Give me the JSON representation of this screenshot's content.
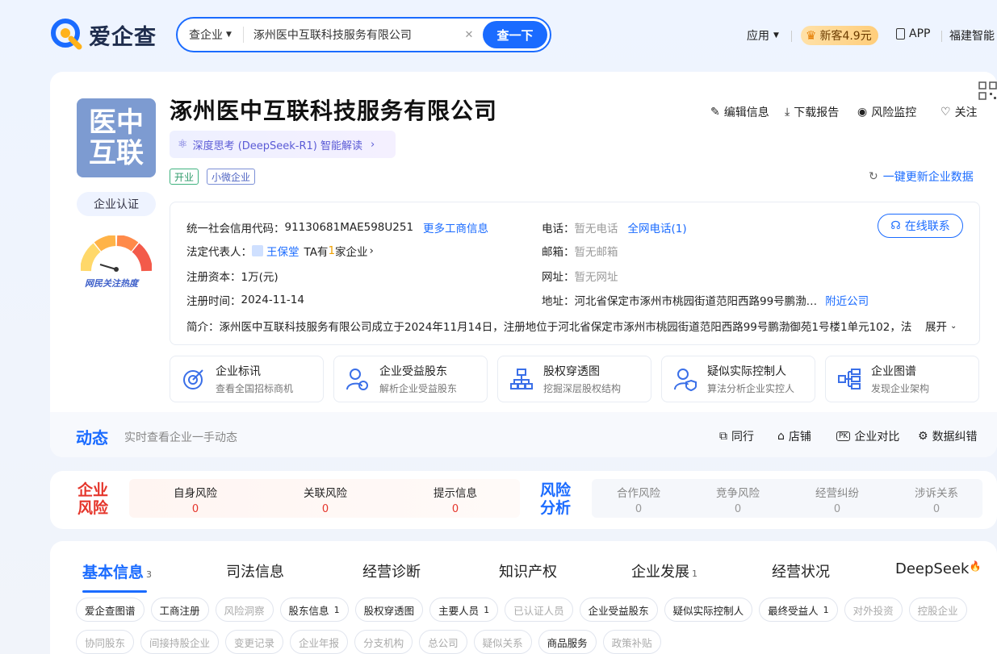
{
  "header": {
    "logo_text": "爱企查",
    "search_type": "查企业",
    "search_value": "涿州医中互联科技服务有限公司",
    "search_button": "查一下",
    "nav_apps": "应用",
    "vip_label": "新客4.9元",
    "nav_app": "APP",
    "nav_more": "福建智能"
  },
  "company": {
    "logo_text_1": "医中",
    "logo_text_2": "互联",
    "certify": "企业认证",
    "heat_label": "网民关注热度",
    "name": "涿州医中互联科技服务有限公司",
    "ai_label": "深度思考 (DeepSeek-R1) 智能解读",
    "tags": [
      "开业",
      "小微企业"
    ],
    "actions": [
      "编辑信息",
      "下载报告",
      "风险监控",
      "关注"
    ],
    "refresh": "一键更新企业数据",
    "credit_code_label": "统一社会信用代码：",
    "credit_code": "91130681MAE598U251",
    "more_biz": "更多工商信息",
    "legal_label": "法定代表人：",
    "legal_name": "王保堂",
    "legal_ta_pre": "TA有",
    "legal_ta_num": "1",
    "legal_ta_post": "家企业",
    "capital_label": "注册资本：",
    "capital": "1万(元)",
    "reg_date_label": "注册时间：",
    "reg_date": "2024-11-14",
    "phone_label": "电话：",
    "phone": "暂无电话",
    "phone_link": "全网电话(1)",
    "email_label": "邮箱：",
    "email": "暂无邮箱",
    "website_label": "网址：",
    "website": "暂无网址",
    "address_label": "地址：",
    "address": "河北省保定市涿州市桃园街道范阳西路99号鹏渤…",
    "nearby": "附近公司",
    "online_contact": "在线联系",
    "intro_label": "简介：",
    "intro": "涿州医中互联科技服务有限公司成立于2024年11月14日，注册地位于河北省保定市涿州市桃园街道范阳西路99号鹏渤御苑1号楼1单元102，法",
    "expand": "展开"
  },
  "features": [
    {
      "title": "企业标讯",
      "sub": "查看全国招标商机"
    },
    {
      "title": "企业受益股东",
      "sub": "解析企业受益股东"
    },
    {
      "title": "股权穿透图",
      "sub": "挖掘深层股权结构"
    },
    {
      "title": "疑似实际控制人",
      "sub": "算法分析企业实控人"
    },
    {
      "title": "企业图谱",
      "sub": "发现企业架构"
    }
  ],
  "dynamics": {
    "title": "动态",
    "subtitle": "实时查看企业一手动态",
    "actions": [
      "同行",
      "店铺",
      "企业对比",
      "数据纠错"
    ]
  },
  "risk": {
    "title_1": "企业",
    "title_2": "风险",
    "items": [
      {
        "label": "自身风险",
        "value": "0"
      },
      {
        "label": "关联风险",
        "value": "0"
      },
      {
        "label": "提示信息",
        "value": "0"
      }
    ],
    "analysis_1": "风险",
    "analysis_2": "分析",
    "analysis": [
      {
        "label": "合作风险",
        "value": "0"
      },
      {
        "label": "竞争风险",
        "value": "0"
      },
      {
        "label": "经营纠纷",
        "value": "0"
      },
      {
        "label": "涉诉关系",
        "value": "0"
      }
    ]
  },
  "tabs": [
    {
      "label": "基本信息",
      "count": "3"
    },
    {
      "label": "司法信息",
      "count": ""
    },
    {
      "label": "经营诊断",
      "count": ""
    },
    {
      "label": "知识产权",
      "count": ""
    },
    {
      "label": "企业发展",
      "count": "1"
    },
    {
      "label": "经营状况",
      "count": ""
    },
    {
      "label": "DeepSeek",
      "count": ""
    }
  ],
  "chips_row1": [
    {
      "label": "爱企查图谱",
      "count": ""
    },
    {
      "label": "工商注册",
      "count": ""
    },
    {
      "label": "风险洞察",
      "count": ""
    },
    {
      "label": "股东信息",
      "count": "1"
    },
    {
      "label": "股权穿透图",
      "count": ""
    },
    {
      "label": "主要人员",
      "count": "1"
    },
    {
      "label": "已认证人员",
      "count": ""
    },
    {
      "label": "企业受益股东",
      "count": ""
    },
    {
      "label": "疑似实际控制人",
      "count": ""
    },
    {
      "label": "最终受益人",
      "count": "1"
    },
    {
      "label": "对外投资",
      "count": ""
    },
    {
      "label": "控股企业",
      "count": ""
    }
  ],
  "chips_row2": [
    {
      "label": "协同股东",
      "count": ""
    },
    {
      "label": "间接持股企业",
      "count": ""
    },
    {
      "label": "变更记录",
      "count": ""
    },
    {
      "label": "企业年报",
      "count": ""
    },
    {
      "label": "分支机构",
      "count": ""
    },
    {
      "label": "总公司",
      "count": ""
    },
    {
      "label": "疑似关系",
      "count": ""
    },
    {
      "label": "商品服务",
      "count": ""
    },
    {
      "label": "政策补贴",
      "count": ""
    }
  ],
  "colors": {
    "accent": "#1a6bff",
    "risk_red": "#e5352b",
    "logo_bg": "#7d9bd1"
  }
}
